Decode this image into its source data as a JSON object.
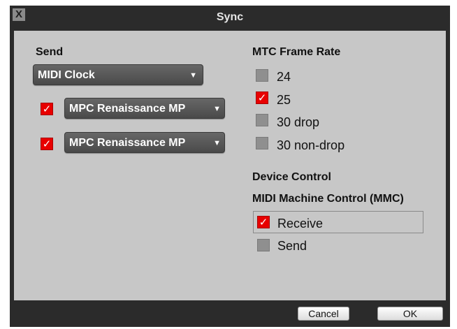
{
  "window": {
    "title": "Sync",
    "close_label": "X"
  },
  "send": {
    "heading": "Send",
    "mode": "MIDI Clock",
    "outputs": [
      {
        "checked": true,
        "device": "MPC Renaissance MP"
      },
      {
        "checked": true,
        "device": "MPC Renaissance MP"
      }
    ]
  },
  "mtc": {
    "heading": "MTC Frame Rate",
    "options": [
      {
        "label": "24",
        "checked": false
      },
      {
        "label": "25",
        "checked": true
      },
      {
        "label": "30 drop",
        "checked": false
      },
      {
        "label": "30 non-drop",
        "checked": false
      }
    ]
  },
  "device_control": {
    "heading": "Device Control",
    "subheading": "MIDI Machine Control (MMC)",
    "receive": {
      "label": "Receive",
      "checked": true
    },
    "send": {
      "label": "Send",
      "checked": false
    }
  },
  "buttons": {
    "cancel": "Cancel",
    "ok": "OK"
  },
  "glyphs": {
    "check": "✓",
    "arrow": "▼"
  }
}
